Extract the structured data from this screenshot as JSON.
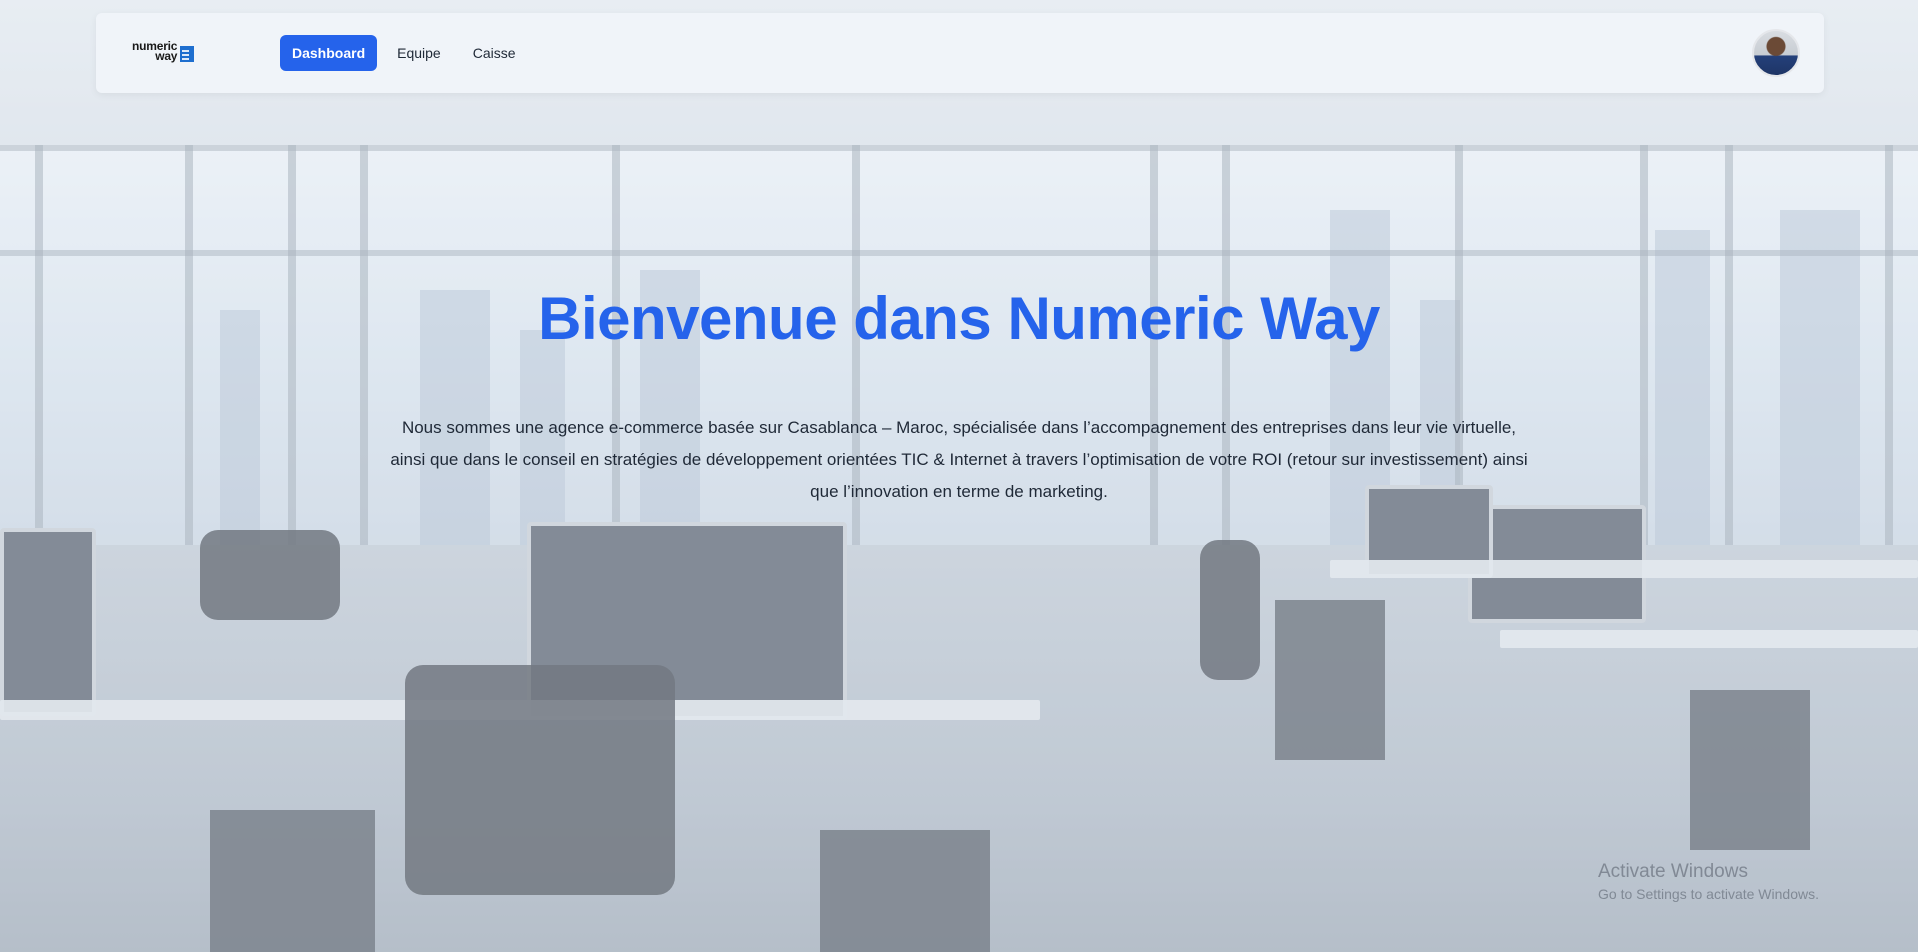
{
  "brand": {
    "logo_line1": "numeric",
    "logo_line2": "way",
    "accent_color": "#2563eb"
  },
  "nav": {
    "items": [
      {
        "label": "Dashboard",
        "active": true
      },
      {
        "label": "Equipe",
        "active": false
      },
      {
        "label": "Caisse",
        "active": false
      }
    ]
  },
  "user": {
    "avatar_icon": "user-avatar"
  },
  "hero": {
    "title": "Bienvenue dans Numeric Way",
    "description": "Nous sommes une agence e-commerce basée sur Casablanca – Maroc, spécialisée dans l’accompagnement des entreprises dans leur vie virtuelle, ainsi que dans le conseil en stratégies de développement orientées TIC & Internet à travers l’optimisation de votre ROI (retour sur investissement) ainsi que l’innovation en terme de marketing."
  },
  "watermark": {
    "title": "Activate Windows",
    "subtitle": "Go to Settings to activate Windows."
  }
}
